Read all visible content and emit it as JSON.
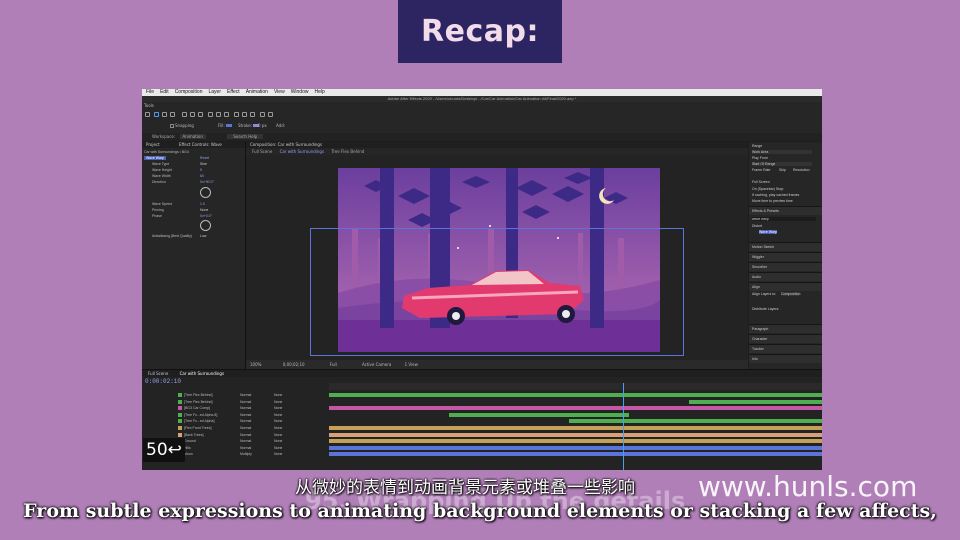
{
  "header": {
    "title": "Recap:"
  },
  "app": {
    "menu": [
      "File",
      "Edit",
      "Composition",
      "Layer",
      "Effect",
      "Animation",
      "View",
      "Window",
      "Help"
    ],
    "window_title": "Adobe After Effects 2020 - /Users/ubunto/Desktop/.../Car/Car Animation/Car Animation #4/Final/2020.aep *",
    "tools_label": "Tools",
    "toolbar_options": [
      "Snapping",
      "Fill:",
      "Stroke:",
      "0 px",
      "Add:"
    ],
    "workspace": {
      "label": "Workspace:",
      "value": "Animation",
      "search": "Search Help"
    }
  },
  "effect_controls": {
    "tabs": [
      "Project",
      "Effect Controls: Wave"
    ],
    "layer": "Car with Surroundings • BG4",
    "rows": [
      {
        "label": "Wave Warp",
        "value": "Reset"
      },
      {
        "label": "Wave Type",
        "value": "Sine"
      },
      {
        "label": "Wave Height",
        "value": "5"
      },
      {
        "label": "Wave Width",
        "value": "60"
      },
      {
        "label": "Direction",
        "value": "0x+90.0°"
      },
      {
        "label": "Wave Speed",
        "value": "1.0"
      },
      {
        "label": "Pinning",
        "value": "None"
      },
      {
        "label": "Phase",
        "value": "0x+0.0°"
      },
      {
        "label": "Antialiasing (Best Quality)",
        "value": "Low"
      }
    ]
  },
  "composition": {
    "tab": "Composition: Car with Surroundings",
    "subtabs": [
      "Full Scene",
      "Car with Surroundings",
      "Tree Flex Behind"
    ],
    "viewer": {
      "zoom": "100%",
      "time": "0;00;02;10",
      "resolution": "Full",
      "camera": "Active Camera",
      "views": "1 View"
    }
  },
  "right_panel": {
    "sections": [
      "Preview",
      "Effects & Presets",
      "Align",
      "Paragraph",
      "Character",
      "Tracker",
      "Info"
    ],
    "rows": [
      "Range",
      "Work Area",
      "Play From",
      "Start Of Range",
      "Frame Rate",
      "Skip",
      "Resolution",
      "Full Screen",
      "On (Spacebar) Stop:",
      "If caching, play cached frames",
      "Move time to preview time",
      "wave warp",
      "Distort",
      "Wave Warp",
      "Motion Sketch",
      "Wiggler",
      "Smoother",
      "Audio",
      "Align Layers to:",
      "Composition",
      "Distribute Layers:"
    ]
  },
  "timeline": {
    "tabs": [
      "Full Scene",
      "Car with Surroundings"
    ],
    "timecode": "0:00:02:10",
    "layers": [
      {
        "name": "[Tree Flex Behind]",
        "mode": "Normal",
        "parent": "None",
        "color": "#4fae4f"
      },
      {
        "name": "[Tree Flex Behind]",
        "mode": "Normal",
        "parent": "None",
        "color": "#4fae4f"
      },
      {
        "name": "[BG3 Car Comp]",
        "mode": "Normal",
        "parent": "None",
        "color": "#c458a6"
      },
      {
        "name": "[Tree Fx...ed Alpha 8]",
        "mode": "Normal",
        "parent": "None",
        "color": "#4fae4f"
      },
      {
        "name": "[Tree Fx...ed Alpha]",
        "mode": "Normal",
        "parent": "None",
        "color": "#4fae4f"
      },
      {
        "name": "[Flex Front Trees]",
        "mode": "Normal",
        "parent": "None",
        "color": "#c4a058"
      },
      {
        "name": "[Back Trees]",
        "mode": "Normal",
        "parent": "None",
        "color": "#d6a07a"
      },
      {
        "name": "Ground",
        "mode": "Normal",
        "parent": "None",
        "color": "#c4a058"
      },
      {
        "name": "Hills",
        "mode": "Normal",
        "parent": "None",
        "color": "#5a74d8"
      },
      {
        "name": "Moon",
        "mode": "Multiply",
        "parent": "None",
        "color": "#5a74d8"
      }
    ]
  },
  "badge": {
    "label": "50↩"
  },
  "subtitles": {
    "chinese": "从微妙的表情到动画背景元素或堆叠一些影响",
    "english": "From subtle expressions to animating background elements or stacking a few affects,",
    "ghost": "95. Wrapping Up the details"
  },
  "watermark": "www.hunls.com",
  "colors": {
    "background": "#b17fb8",
    "recap_box": "#2d2562",
    "accent": "#4aa0f0"
  }
}
